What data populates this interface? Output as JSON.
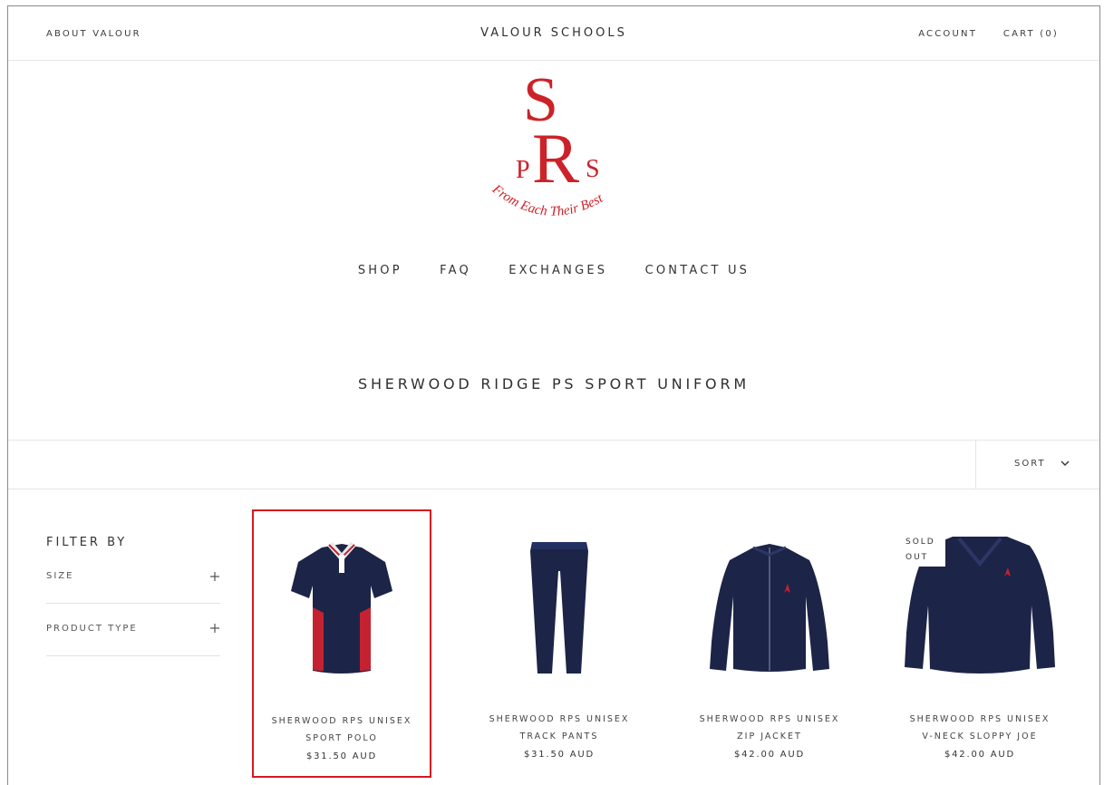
{
  "header": {
    "about": "ABOUT VALOUR",
    "brand": "VALOUR SCHOOLS",
    "account": "ACCOUNT",
    "cart": "CART (0)"
  },
  "logo": {
    "monogram_s_top": "S",
    "monogram_p": "P",
    "monogram_r": "R",
    "monogram_s_small": "S",
    "motto": "From Each Their Best",
    "color": "#cc2229"
  },
  "nav": [
    "SHOP",
    "FAQ",
    "EXCHANGES",
    "CONTACT US"
  ],
  "page_title": "SHERWOOD RIDGE PS SPORT UNIFORM",
  "toolbar": {
    "sort_label": "SORT",
    "sort_icon": "chevron-down-icon"
  },
  "filter": {
    "title": "FILTER BY",
    "groups": [
      {
        "label": "SIZE",
        "icon": "plus-icon"
      },
      {
        "label": "PRODUCT TYPE",
        "icon": "plus-icon"
      }
    ]
  },
  "products": [
    {
      "name_line1": "SHERWOOD RPS UNISEX",
      "name_line2": "SPORT POLO",
      "price": "$31.50 AUD",
      "image": "polo-shirt-icon"
    },
    {
      "name_line1": "SHERWOOD RPS UNISEX",
      "name_line2": "TRACK PANTS",
      "price": "$31.50 AUD",
      "image": "track-pants-icon"
    },
    {
      "name_line1": "SHERWOOD RPS UNISEX",
      "name_line2": "ZIP JACKET",
      "price": "$42.00 AUD",
      "image": "zip-jacket-icon"
    },
    {
      "name_line1": "SHERWOOD RPS UNISEX",
      "name_line2": "V-NECK SLOPPY JOE",
      "price": "$42.00 AUD",
      "image": "sweater-icon",
      "badge_line1": "SOLD",
      "badge_line2": "OUT"
    }
  ],
  "colors": {
    "navy": "#1c2447",
    "red": "#c42230",
    "highlight": "#d7181f"
  }
}
